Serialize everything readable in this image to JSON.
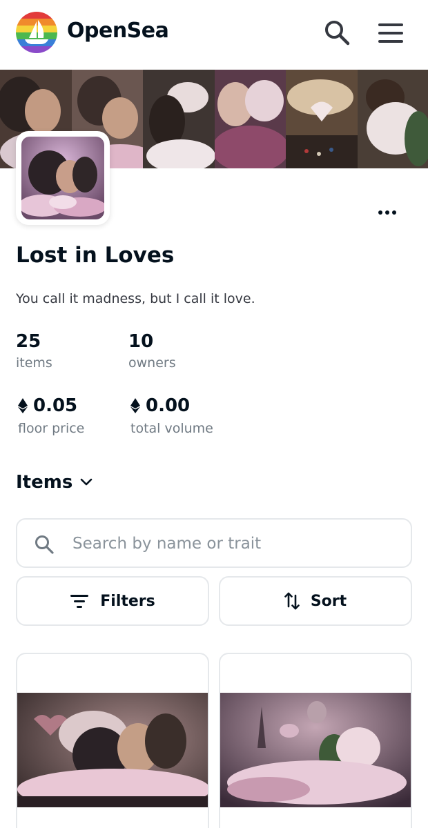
{
  "header": {
    "brand": "OpenSea",
    "logo_icon": "opensea-rainbow-logo",
    "search_icon": "search-icon",
    "menu_icon": "hamburger-menu-icon"
  },
  "collection": {
    "name": "Lost in Loves",
    "description": "You call it madness, but I call it love.",
    "stats": {
      "items_value": "25",
      "items_label": "items",
      "owners_value": "10",
      "owners_label": "owners",
      "floor_value": "0.05",
      "floor_label": "floor price",
      "volume_value": "0.00",
      "volume_label": "total volume"
    }
  },
  "items_section": {
    "heading": "Items",
    "search_placeholder": "Search by name or trait",
    "filters_label": "Filters",
    "sort_label": "Sort"
  },
  "colors": {
    "text": "#04111d",
    "muted": "#707a83",
    "border": "#e5e8eb",
    "painting_pink": "#c9a3b8",
    "painting_dark": "#2a1f26"
  }
}
